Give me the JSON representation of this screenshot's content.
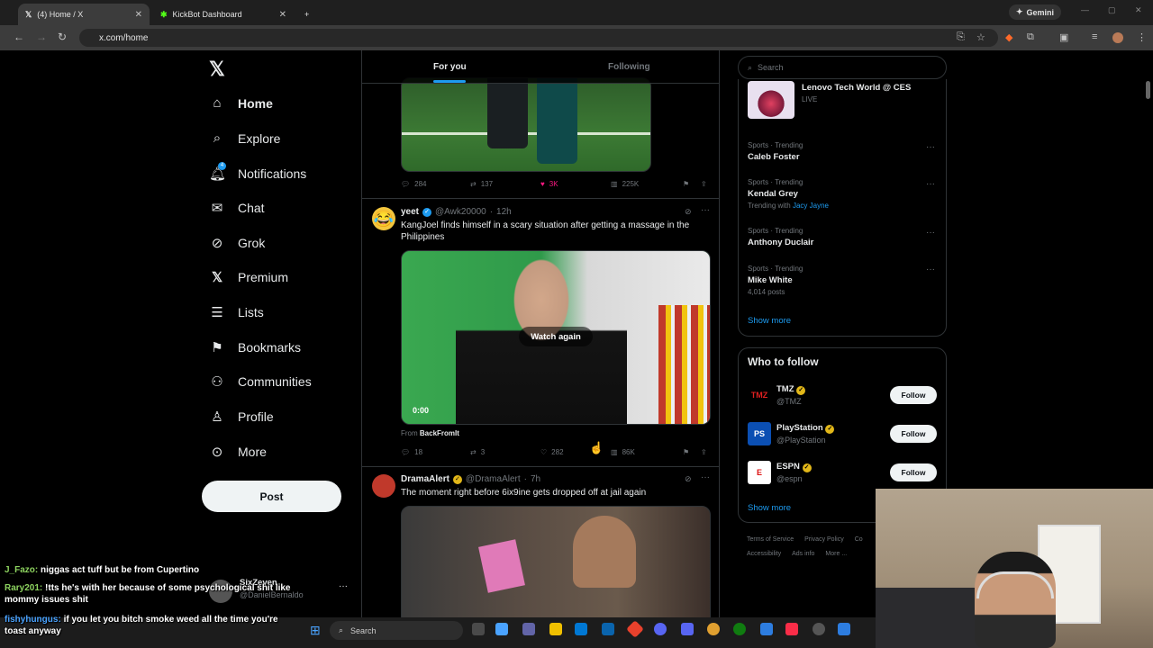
{
  "browser": {
    "tabs": [
      {
        "title": "(4) Home / X"
      },
      {
        "title": "KickBot Dashboard"
      }
    ],
    "gemini_label": "Gemini",
    "url": "x.com/home"
  },
  "sidebar": {
    "items": [
      {
        "label": "Home"
      },
      {
        "label": "Explore"
      },
      {
        "label": "Notifications"
      },
      {
        "label": "Chat"
      },
      {
        "label": "Grok"
      },
      {
        "label": "Premium"
      },
      {
        "label": "Lists"
      },
      {
        "label": "Bookmarks"
      },
      {
        "label": "Communities"
      },
      {
        "label": "Profile"
      },
      {
        "label": "More"
      }
    ],
    "post_button": "Post",
    "account_name": "SixZeven",
    "account_handle": "@DanielBernaldo"
  },
  "feed": {
    "tabs": [
      "For you",
      "Following"
    ],
    "post1": {
      "replies": "284",
      "reposts": "137",
      "likes": "3K",
      "views": "225K"
    },
    "post2": {
      "name": "yeet",
      "handle": "@Awk20000",
      "time": "12h",
      "text": "KangJoel finds himself in a scary situation after getting a massage in the Philippines",
      "video_button": "Watch again",
      "video_time": "0:00",
      "from_label": "From",
      "from_account": "BackFromIt",
      "replies": "18",
      "reposts": "3",
      "likes": "282",
      "views": "86K"
    },
    "post3": {
      "name": "DramaAlert",
      "handle": "@DramaAlert",
      "time": "7h",
      "text": "The moment right before 6ix9ine gets dropped off at jail again"
    }
  },
  "right": {
    "search_placeholder": "Search",
    "live": {
      "title": "Lenovo Tech World @ CES",
      "status": "LIVE"
    },
    "trends": [
      {
        "category": "Sports · Trending",
        "name": "Caleb Foster"
      },
      {
        "category": "Sports · Trending",
        "name": "Kendal Grey",
        "sub_prefix": "Trending with",
        "sub_link": "Jacy Jayne"
      },
      {
        "category": "Sports · Trending",
        "name": "Anthony Duclair"
      },
      {
        "category": "Sports · Trending",
        "name": "Mike White",
        "sub": "4,014 posts"
      }
    ],
    "show_more": "Show more",
    "who_to_follow": "Who to follow",
    "accounts": [
      {
        "name": "TMZ",
        "handle": "@TMZ",
        "button": "Follow"
      },
      {
        "name": "PlayStation",
        "handle": "@PlayStation",
        "button": "Follow"
      },
      {
        "name": "ESPN",
        "handle": "@espn",
        "button": "Follow"
      }
    ],
    "show_more_2": "Show more",
    "footer": [
      "Terms of Service",
      "Privacy Policy",
      "Co",
      "Accessibility",
      "Ads info",
      "More ..."
    ]
  },
  "chat": [
    {
      "user": "J_Fazo:",
      "msg": "niggas act tuff but be from Cupertino"
    },
    {
      "user": "Rary201:",
      "msg": "!tts he's with her because of some psychological shit like mommy issues shit"
    },
    {
      "user": "fishyhungus:",
      "msg": "if you let you bitch smoke weed all the time you're toast anyway"
    }
  ],
  "taskbar": {
    "search": "Search"
  }
}
